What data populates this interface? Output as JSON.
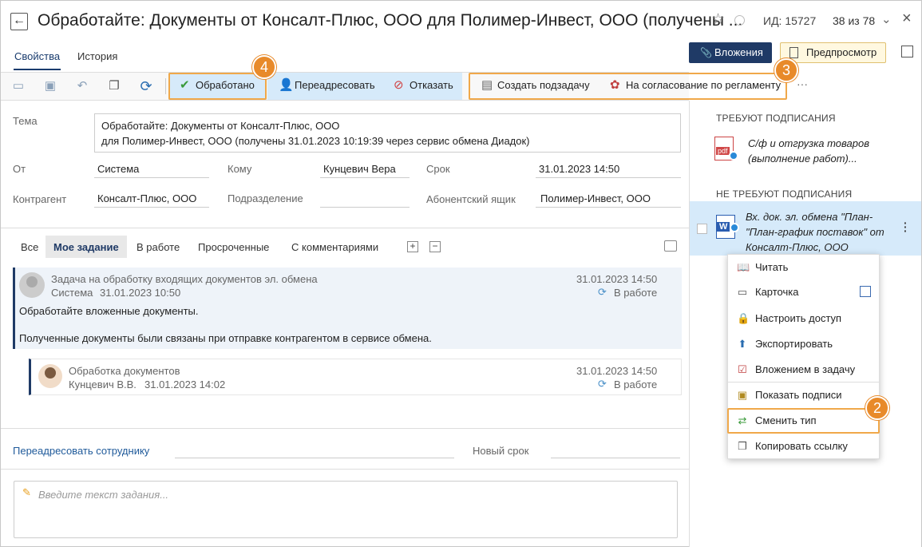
{
  "header": {
    "title": "Обработайте: Документы от Консалт-Плюс, ООО для Полимер-Инвест, ООО (получены ...",
    "id_text": "ИД: 15727",
    "counter": "38 из 78"
  },
  "tabs": [
    {
      "label": "Свойства",
      "active": true
    },
    {
      "label": "История",
      "active": false
    }
  ],
  "header_buttons": {
    "attachments": "Вложения",
    "preview": "Предпросмотр"
  },
  "toolbar": {
    "processed": "Обработано",
    "forward": "Переадресовать",
    "refuse": "Отказать",
    "create_subtask": "Создать подзадачу",
    "approval": "На согласование по регламенту",
    "more": "···"
  },
  "callouts": {
    "c4": "4",
    "c3": "3",
    "c2": "2"
  },
  "fields": {
    "subject_label": "Тема",
    "subject_line1": "Обработайте: Документы от Консалт-Плюс, ООО",
    "subject_line2": "для Полимер-Инвест, ООО (получены 31.01.2023 10:19:39 через сервис обмена Диадок)",
    "from_label": "От",
    "from_value": "Система",
    "to_label": "Кому",
    "to_value": "Кунцевич Вера",
    "deadline_label": "Срок",
    "deadline_value": "31.01.2023 14:50",
    "counterparty_label": "Контрагент",
    "counterparty_value": "Консалт-Плюс, ООО",
    "department_label": "Подразделение",
    "department_value": "",
    "mailbox_label": "Абонентский ящик",
    "mailbox_value": "Полимер-Инвест, ООО"
  },
  "filters": [
    "Все",
    "Мое задание",
    "В работе",
    "Просроченные",
    "С комментариями"
  ],
  "task": {
    "title": "Задача на обработку входящих документов эл. обмена",
    "author": "Система",
    "created": "31.01.2023 10:50",
    "deadline": "31.01.2023 14:50",
    "status": "В работе",
    "text1": "Обработайте вложенные документы.",
    "text2": "Полученные документы были связаны при отправке контрагентом в сервисе обмена."
  },
  "subtask": {
    "title": "Обработка документов",
    "author": "Кунцевич В.В.",
    "created": "31.01.2023 14:02",
    "deadline": "31.01.2023 14:50",
    "status": "В работе"
  },
  "redirect": {
    "link": "Переадресовать сотруднику",
    "new_deadline_label": "Новый срок"
  },
  "input": {
    "placeholder": "Введите текст задания..."
  },
  "right_panel": {
    "need_sign_header": "ТРЕБУЮТ ПОДПИСАНИЯ",
    "doc1_line1": "С/ф и отгрузка товаров",
    "doc1_line2": "(выполнение работ)...",
    "doc1_icon_text": "pdf",
    "no_sign_header": "НЕ ТРЕБУЮТ ПОДПИСАНИЯ",
    "doc2_line1": "Вх. док. эл. обмена \"План-",
    "doc2_line2": "\"План-график поставок\" от",
    "doc2_line3": "Консалт-Плюс, ООО",
    "doc2_icon_text": "W"
  },
  "context_menu": {
    "read": "Читать",
    "card": "Карточка",
    "access": "Настроить доступ",
    "export": "Экспортировать",
    "attach_to_task": "Вложением в задачу",
    "show_signatures": "Показать подписи",
    "change_type": "Сменить тип",
    "copy_link": "Копировать ссылку"
  },
  "colors": {
    "accent": "#1f3a66",
    "highlight": "#f0a84a",
    "badge": "#e88a2a",
    "selection": "#d6eafa"
  }
}
